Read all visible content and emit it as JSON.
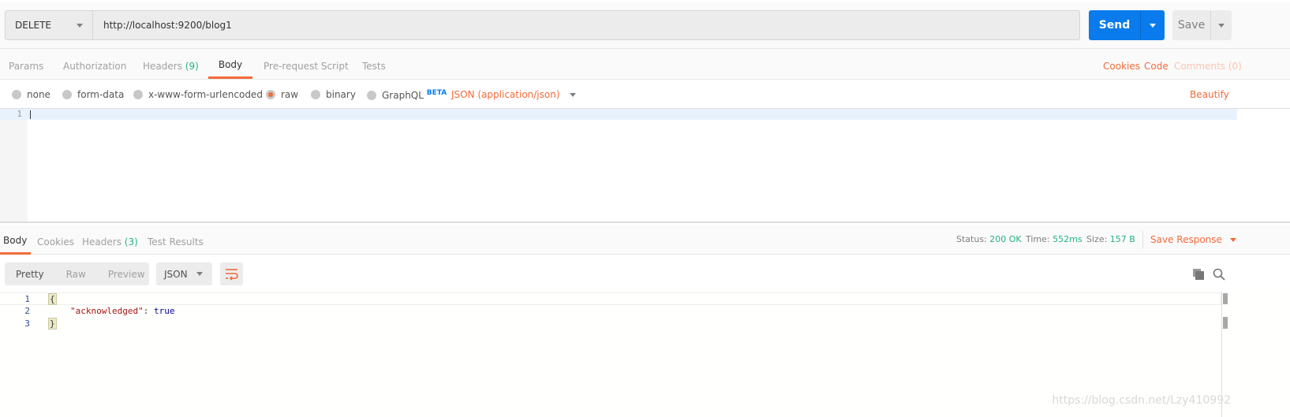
{
  "request": {
    "method": "DELETE",
    "url": "http://localhost:9200/blog1",
    "send_label": "Send",
    "save_label": "Save"
  },
  "request_tabs": [
    {
      "label": "Params"
    },
    {
      "label": "Authorization"
    },
    {
      "label": "Headers",
      "count": "(9)"
    },
    {
      "label": "Body",
      "active": true
    },
    {
      "label": "Pre-request Script"
    },
    {
      "label": "Tests"
    }
  ],
  "request_links": {
    "cookies": "Cookies",
    "code": "Code",
    "comments": "Comments (0)"
  },
  "body_types": {
    "none": "none",
    "form_data": "form-data",
    "urlencoded": "x-www-form-urlencoded",
    "raw": "raw",
    "binary": "binary",
    "graphql": "GraphQL",
    "beta": "BETA",
    "selected": "raw",
    "content_type": "JSON (application/json)",
    "beautify": "Beautify"
  },
  "editor": {
    "line_numbers": [
      "1"
    ]
  },
  "response_tabs": [
    {
      "label": "Body",
      "active": true
    },
    {
      "label": "Cookies"
    },
    {
      "label": "Headers",
      "count": "(3)"
    },
    {
      "label": "Test Results"
    }
  ],
  "status": {
    "status_label": "Status:",
    "status_value": "200 OK",
    "time_label": "Time:",
    "time_value": "552ms",
    "size_label": "Size:",
    "size_value": "157 B",
    "save_response": "Save Response"
  },
  "response_toolbar": {
    "views": [
      "Pretty",
      "Raw",
      "Preview"
    ],
    "selected_view": "Pretty",
    "format": "JSON"
  },
  "response_body": {
    "lines": [
      "1",
      "2",
      "3"
    ],
    "open": "{",
    "key": "\"acknowledged\"",
    "colon": ": ",
    "value": "true",
    "close": "}"
  },
  "watermark": "https://blog.csdn.net/Lzy410992",
  "colors": {
    "accent": "#f26b3a",
    "send": "#097bed",
    "success": "#26b47f"
  }
}
